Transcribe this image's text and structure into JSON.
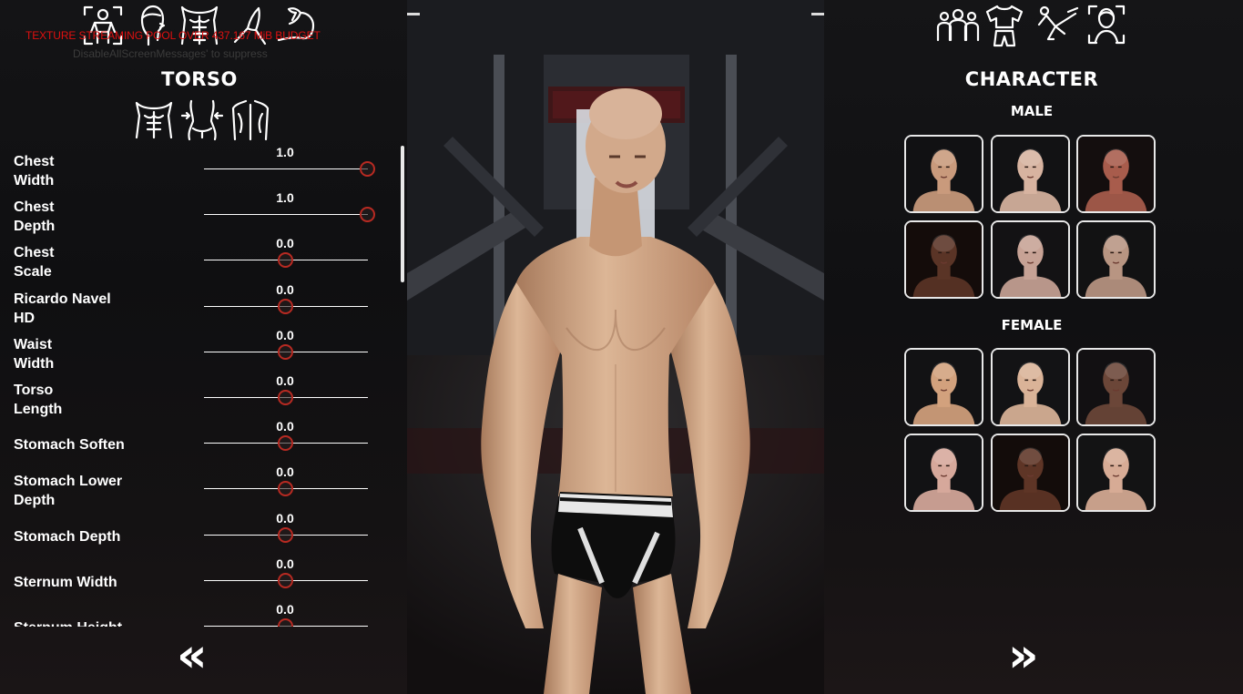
{
  "debug": {
    "warning": "TEXTURE STREAMING POOL OVER 437.167 MiB BUDGET",
    "hint": "DisableAllScreenMessages' to suppress"
  },
  "left_panel": {
    "category_icons": [
      "body-icon",
      "head-icon",
      "torso-icon",
      "legs-icon",
      "arm-icon"
    ],
    "title": "TORSO",
    "sub_icons": [
      "chest-icon",
      "waist-icon",
      "back-icon"
    ],
    "sliders": [
      {
        "label": "Chest\nWidth",
        "value": "1.0",
        "level": 1.0
      },
      {
        "label": "Chest\nDepth",
        "value": "1.0",
        "level": 1.0
      },
      {
        "label": "Chest\nScale",
        "value": "0.0",
        "level": 0.5
      },
      {
        "label": "Ricardo Navel\nHD",
        "value": "0.0",
        "level": 0.5
      },
      {
        "label": "Waist\nWidth",
        "value": "0.0",
        "level": 0.5
      },
      {
        "label": "Torso\nLength",
        "value": "0.0",
        "level": 0.5
      },
      {
        "label": "Stomach Soften",
        "value": "0.0",
        "level": 0.5
      },
      {
        "label": "Stomach Lower\nDepth",
        "value": "0.0",
        "level": 0.5
      },
      {
        "label": "Stomach Depth",
        "value": "0.0",
        "level": 0.5
      },
      {
        "label": "Sternum Width",
        "value": "0.0",
        "level": 0.5
      },
      {
        "label": "Sternum Height",
        "value": "0.0",
        "level": 0.5
      }
    ],
    "prev_arrow": "«"
  },
  "right_panel": {
    "category_icons": [
      "group-icon",
      "clothing-icon",
      "pose-icon",
      "face-scan-icon"
    ],
    "title": "CHARACTER",
    "male_label": "MALE",
    "female_label": "FEMALE",
    "male_presets": [
      {
        "skin": "#c99a7c",
        "bg": "#111113"
      },
      {
        "skin": "#d7b3a0",
        "bg": "#121214"
      },
      {
        "skin": "#a85c4c",
        "bg": "#140e0e"
      },
      {
        "skin": "#5a3426",
        "bg": "#140c0a"
      },
      {
        "skin": "#c7a295",
        "bg": "#131214"
      },
      {
        "skin": "#b89582",
        "bg": "#121213"
      }
    ],
    "female_presets": [
      {
        "skin": "#d2a17d",
        "bg": "#121214"
      },
      {
        "skin": "#dab398",
        "bg": "#131315"
      },
      {
        "skin": "#6b4638",
        "bg": "#121012"
      },
      {
        "skin": "#d6a89b",
        "bg": "#121214"
      },
      {
        "skin": "#5e3526",
        "bg": "#130c0a"
      },
      {
        "skin": "#d7ab95",
        "bg": "#131314"
      }
    ],
    "next_arrow": "»"
  },
  "colors": {
    "slider_thumb": "#b82a22",
    "warning": "#e01010",
    "panel_bg": "#111113",
    "skin": "#d3a785"
  }
}
